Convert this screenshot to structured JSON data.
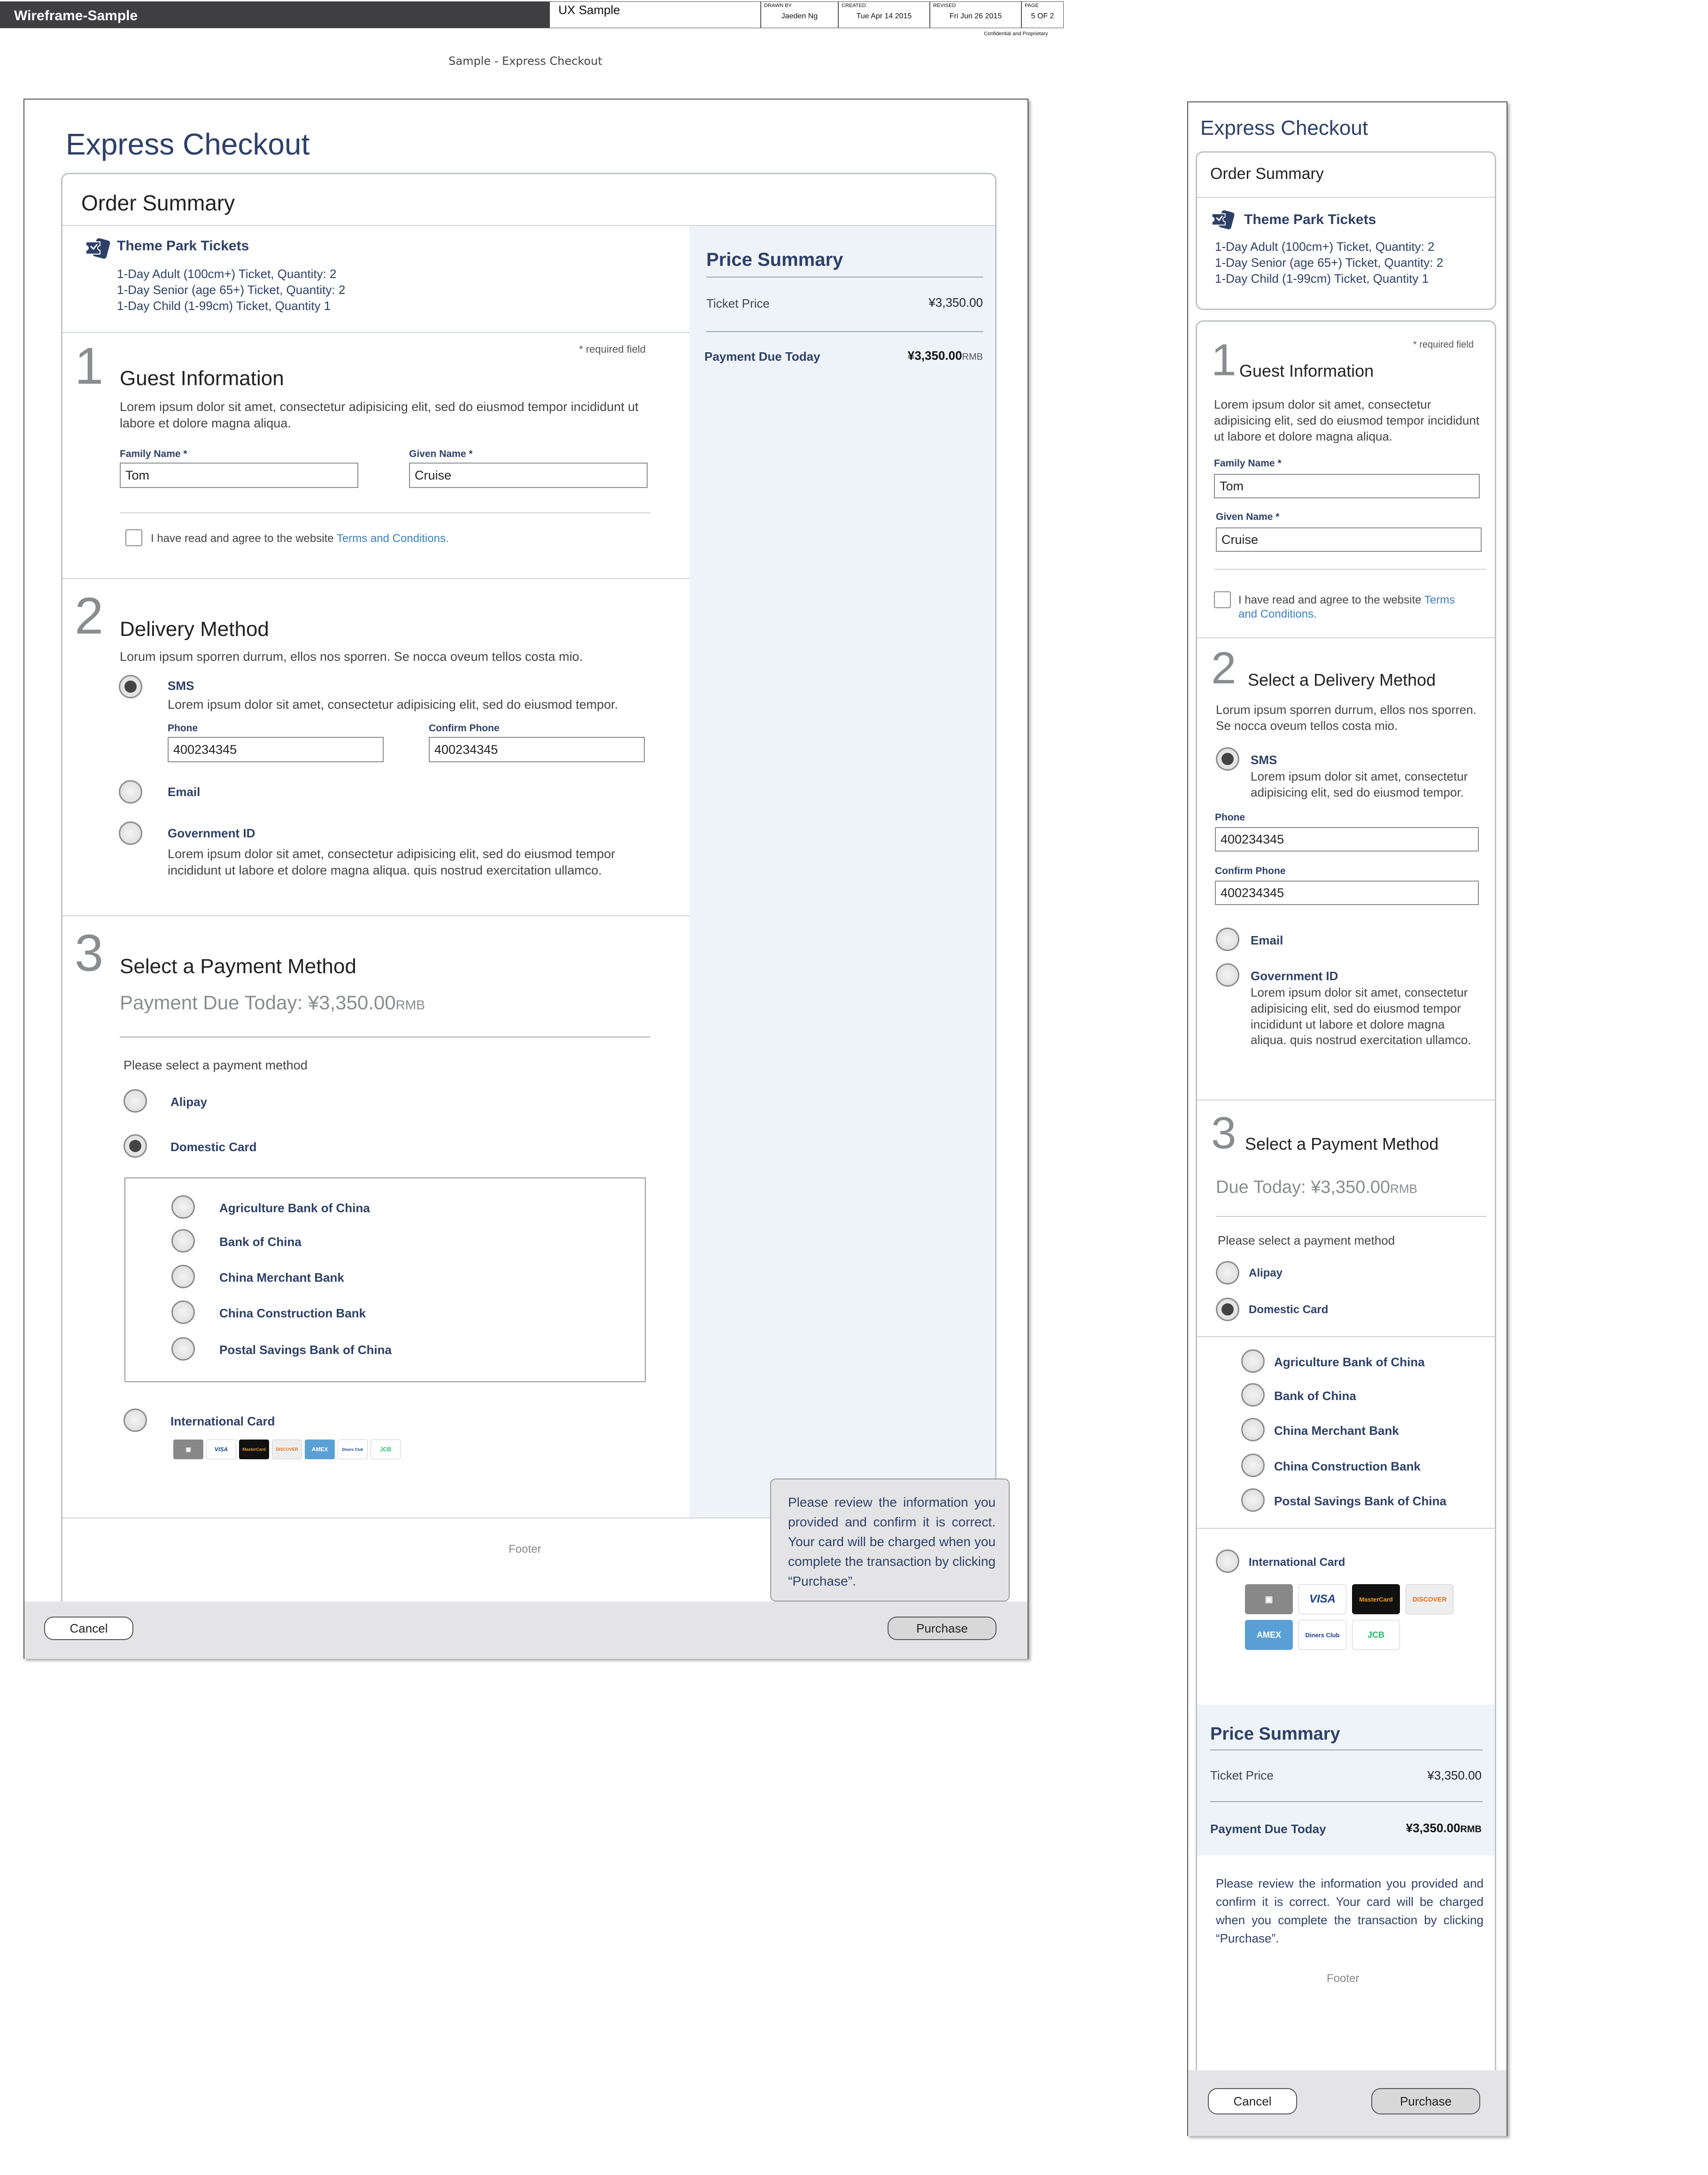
{
  "titleblock": {
    "project": "Wireframe-Sample",
    "doc": "UX Sample",
    "drawn_by_label": "DRAWN BY",
    "drawn_by": "Jaeden Ng",
    "created_label": "CREATED",
    "created": "Tue Apr 14 2015",
    "revised_label": "REVISED",
    "revised": "Fri Jun 26 2015",
    "page_label": "PAGE",
    "page": "5 OF 2",
    "confidential": "Confidential and Proprietary"
  },
  "doc_subtitle": "Sample - Express Checkout",
  "desktop": {
    "title": "Express Checkout",
    "order_summary": {
      "title": "Order Summary",
      "product": "Theme Park Tickets",
      "lines": [
        "1-Day Adult (100cm+) Ticket, Quantity: 2",
        "1-Day Senior (age 65+) Ticket, Quantity: 2",
        "1-Day Child (1-99cm) Ticket, Quantity 1"
      ]
    },
    "required": "* required field",
    "guest": {
      "num": "1",
      "title": "Guest Information",
      "desc": "Lorem ipsum dolor sit amet, consectetur adipisicing elit, sed do eiusmod tempor incididunt ut labore et dolore magna aliqua.",
      "family_label": "Family Name *",
      "family_value": "Tom",
      "given_label": "Given Name *",
      "given_value": "Cruise",
      "agree_text": "I have read and agree to the website ",
      "agree_link": "Terms and Conditions."
    },
    "delivery": {
      "num": "2",
      "title": "Delivery Method",
      "desc": "Lorum ipsum sporren durrum, ellos nos sporren. Se nocca oveum tellos costa mio.",
      "sms": "SMS",
      "sms_desc": "Lorem ipsum dolor sit amet, consectetur adipisicing elit, sed do eiusmod tempor.",
      "phone_label": "Phone",
      "phone_value": "400234345",
      "confirm_label": "Confirm Phone",
      "confirm_value": "400234345",
      "email": "Email",
      "gov": "Government ID",
      "gov_desc": "Lorem ipsum dolor sit amet, consectetur adipisicing elit, sed do eiusmod tempor incididunt ut labore et dolore magna aliqua. quis nostrud exercitation ullamco."
    },
    "payment": {
      "num": "3",
      "title": "Select a Payment Method",
      "due_label": "Payment Due Today: ",
      "due_amount": "¥3,350.00",
      "due_currency": "RMB",
      "prompt": "Please select a payment method",
      "alipay": "Alipay",
      "domestic": "Domestic Card",
      "banks": [
        "Agriculture Bank of China",
        "Bank of China",
        "China Merchant Bank",
        "China Construction Bank",
        "Postal Savings Bank of China"
      ],
      "international": "International Card"
    },
    "price": {
      "title": "Price Summary",
      "ticket_label": "Ticket Price",
      "ticket_value": "¥3,350.00",
      "due_label": "Payment Due Today",
      "due_value": "¥3,350.00",
      "due_currency": "RMB"
    },
    "callout": "Please review the information you provided and confirm it is correct. Your card will be charged when you complete the transaction by clicking “Purchase”.",
    "footer": "Footer",
    "cancel": "Cancel",
    "purchase": "Purchase"
  },
  "mobile": {
    "title": "Express Checkout",
    "order_title": "Order Summary",
    "product": "Theme Park Tickets",
    "lines": [
      "1-Day Adult (100cm+) Ticket, Quantity: 2",
      "1-Day Senior (age 65+) Ticket, Quantity: 2",
      "1-Day Child (1-99cm) Ticket, Quantity 1"
    ],
    "required": "* required field",
    "guest_num": "1",
    "guest_title": "Guest Information",
    "guest_desc": "Lorem ipsum dolor sit amet, consectetur adipisicing elit, sed do eiusmod tempor incididunt ut labore et dolore magna aliqua.",
    "family_label": "Family Name *",
    "family_value": "Tom",
    "given_label": "Given Name *",
    "given_value": "Cruise",
    "agree_text": "I have read and agree to the website ",
    "agree_link1": "Terms",
    "agree_link2": "and Conditions.",
    "del_num": "2",
    "del_title": "Select a Delivery Method",
    "del_desc": "Lorum ipsum sporren durrum, ellos nos sporren. Se nocca oveum tellos costa mio.",
    "sms": "SMS",
    "sms_desc": "Lorem ipsum dolor sit amet, consectetur adipisicing elit, sed do eiusmod tempor.",
    "phone_label": "Phone",
    "phone_value": "400234345",
    "confirm_label": "Confirm Phone",
    "confirm_value": "400234345",
    "email": "Email",
    "gov": "Government ID",
    "gov_desc": "Lorem ipsum dolor sit amet, consectetur adipisicing elit, sed do eiusmod tempor incididunt ut labore et dolore magna aliqua. quis nostrud exercitation ullamco.",
    "pay_num": "3",
    "pay_title": "Select a Payment Method",
    "due_label": "Due Today: ",
    "due_amount": "¥3,350.00",
    "due_currency": "RMB",
    "prompt": "Please select a payment method",
    "alipay": "Alipay",
    "domestic": "Domestic Card",
    "banks": [
      "Agriculture Bank of China",
      "Bank of China",
      "China Merchant Bank",
      "China Construction Bank",
      "Postal Savings Bank of China"
    ],
    "international": "International Card",
    "price_title": "Price Summary",
    "ticket_label": "Ticket Price",
    "ticket_value": "¥3,350.00",
    "pdue_label": "Payment Due Today",
    "pdue_value": "¥3,350.00",
    "pdue_currency": "RMB",
    "notice": "Please review the information you provided and confirm it is correct. Your card will be charged when you complete the transaction by clicking “Purchase”.",
    "footer": "Footer",
    "cancel": "Cancel",
    "purchase": "Purchase"
  },
  "card_brands": [
    "VISA",
    "MasterCard",
    "DISCOVER",
    "AMEX",
    "Diners Club",
    "JCB"
  ],
  "colors": {
    "navy": "#2e4068",
    "link": "#3d7fbf",
    "price_bg": "#edf3f9",
    "bar": "#e4e4e6"
  }
}
